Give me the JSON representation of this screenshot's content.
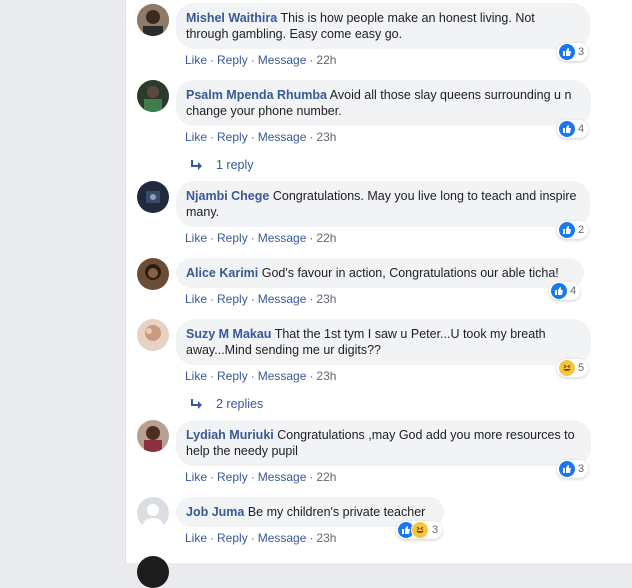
{
  "comments": [
    {
      "author": "Mishel Waithira",
      "text": "This is how people make an honest living. Not through gambling. Easy come easy go.",
      "reactions": "3",
      "reaction_types": [
        "like"
      ],
      "time": "22h"
    },
    {
      "author": "Psalm Mpenda Rhumba",
      "text": "Avoid all those slay queens surrounding u n change your phone number.",
      "reactions": "4",
      "reaction_types": [
        "like"
      ],
      "time": "23h",
      "replies": "1 reply"
    },
    {
      "author": "Njambi Chege",
      "text": "Congratulations. May you live long to teach and inspire many.",
      "reactions": "2",
      "reaction_types": [
        "like"
      ],
      "time": "22h"
    },
    {
      "author": "Alice Karimi",
      "text": "God's favour in action, Congratulations our able ticha!",
      "reactions": "4",
      "reaction_types": [
        "like"
      ],
      "time": "23h"
    },
    {
      "author": "Suzy M Makau",
      "text": "That the 1st tym I saw u Peter...U took my breath away...Mind sending me ur digits??",
      "reactions": "5",
      "reaction_types": [
        "haha"
      ],
      "time": "23h",
      "replies": "2 replies"
    },
    {
      "author": "Lydiah Muriuki",
      "text": "Congratulations ,may God add you more resources to help the needy pupil",
      "reactions": "3",
      "reaction_types": [
        "like"
      ],
      "time": "22h"
    },
    {
      "author": "Job Juma",
      "text": "Be my children's private teacher",
      "reactions": "3",
      "reaction_types": [
        "like",
        "haha"
      ],
      "time": "23h"
    }
  ],
  "actions": {
    "like": "Like",
    "reply": "Reply",
    "message": "Message",
    "separator": "·"
  },
  "colors": {
    "link": "#385898",
    "bubble": "#f2f3f5",
    "like": "#1877f2",
    "haha": "#f7c43d"
  }
}
